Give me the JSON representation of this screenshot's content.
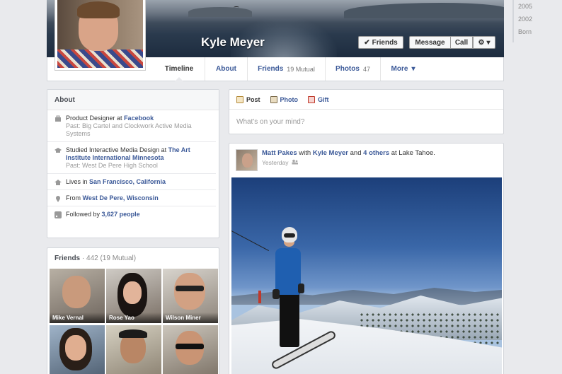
{
  "profile": {
    "name": "Kyle Meyer"
  },
  "cover_buttons": {
    "friends": "Friends",
    "friends_icon": "checkmark-icon",
    "message": "Message",
    "call": "Call",
    "settings_icon": "gear-icon"
  },
  "tabs": [
    {
      "label": "Timeline",
      "count": ""
    },
    {
      "label": "About",
      "count": ""
    },
    {
      "label": "Friends",
      "count": "19 Mutual"
    },
    {
      "label": "Photos",
      "count": "47"
    },
    {
      "label": "More",
      "count": ""
    }
  ],
  "years": [
    "2005",
    "2002",
    "Born"
  ],
  "about": {
    "title": "About",
    "work_title": "Product Designer at",
    "work_company": "Facebook",
    "work_past": "Past: Big Cartel and Clockwork Active Media Systems",
    "edu_title": "Studied Interactive Media Design at",
    "edu_school": "The Art Institute International Minnesota",
    "edu_past": "Past: West De Pere High School",
    "lives_label": "Lives in",
    "lives_place": "San Francisco, California",
    "from_label": "From",
    "from_place": "West De Pere, Wisconsin",
    "followed_label": "Followed by",
    "followed_count": "3,627 people"
  },
  "friends_box": {
    "title": "Friends",
    "count": "· 442 (19 Mutual)",
    "people": [
      "Mike Vernal",
      "Rose Yao",
      "Wilson Miner",
      "",
      "",
      ""
    ]
  },
  "composer": {
    "post": "Post",
    "photo": "Photo",
    "gift": "Gift",
    "placeholder": "What's on your mind?"
  },
  "story": {
    "author": "Matt Pakes",
    "with": "with",
    "tagged": "Kyle Meyer",
    "and": "and",
    "others": "4 others",
    "at": "at Lake Tahoe.",
    "time": "Yesterday"
  },
  "colors": {
    "brand": "#3b5998",
    "background": "#e9eaed"
  }
}
